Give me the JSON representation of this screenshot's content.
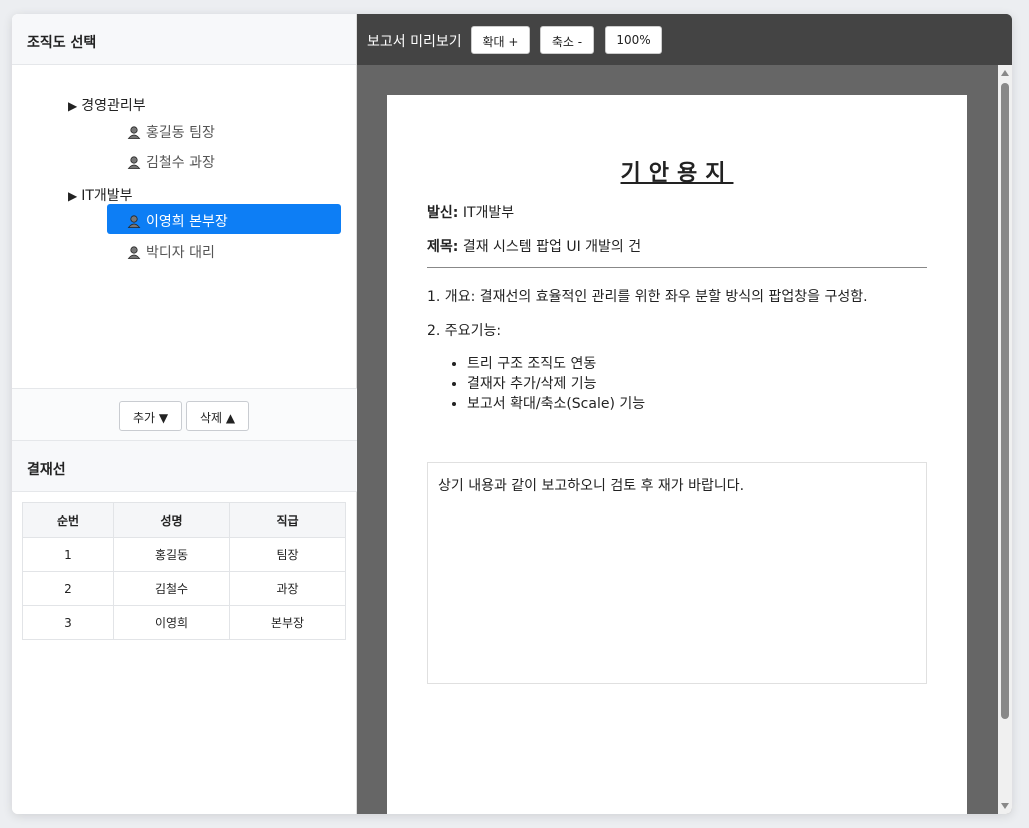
{
  "org": {
    "title": "조직도 선택",
    "departments": [
      {
        "name": "경영관리부",
        "members": [
          {
            "name": "홍길동 팀장"
          },
          {
            "name": "김철수 과장"
          }
        ]
      },
      {
        "name": "IT개발부",
        "members": [
          {
            "name": "이영희 본부장"
          },
          {
            "name": "박디자 대리"
          }
        ]
      }
    ],
    "selected": "이영희 본부장",
    "add_label": "추가 ▼",
    "remove_label": "삭제 ▲"
  },
  "approval": {
    "title": "결재선",
    "columns": [
      "순번",
      "성명",
      "직급"
    ],
    "rows": [
      [
        "1",
        "홍길동",
        "팀장"
      ],
      [
        "2",
        "김철수",
        "과장"
      ],
      [
        "3",
        "이영희",
        "본부장"
      ]
    ]
  },
  "preview": {
    "title": "보고서 미리보기",
    "zoom_in_label": "확대 +",
    "zoom_out_label": "축소 -",
    "zoom_level": "100%"
  },
  "document": {
    "title": "기안용지",
    "sender_label": "발신:",
    "sender_value": "IT개발부",
    "subject_label": "제목:",
    "subject_value": "결재 시스템 팝업 UI 개발의 건",
    "overview": "1. 개요: 결재선의 효율적인 관리를 위한 좌우 분할 방식의 팝업창을 구성함.",
    "features_heading": "2. 주요기능:",
    "features": [
      "트리 구조 조직도 연동",
      "결재자 추가/삭제 기능",
      "보고서 확대/축소(Scale) 기능"
    ],
    "closing": "상기 내용과 같이 보고하오니 검토 후 재가 바랍니다."
  },
  "colors": {
    "selected_bg": "#0d7ef5",
    "toolbar_bg": "#444444",
    "preview_bg": "#666666"
  }
}
